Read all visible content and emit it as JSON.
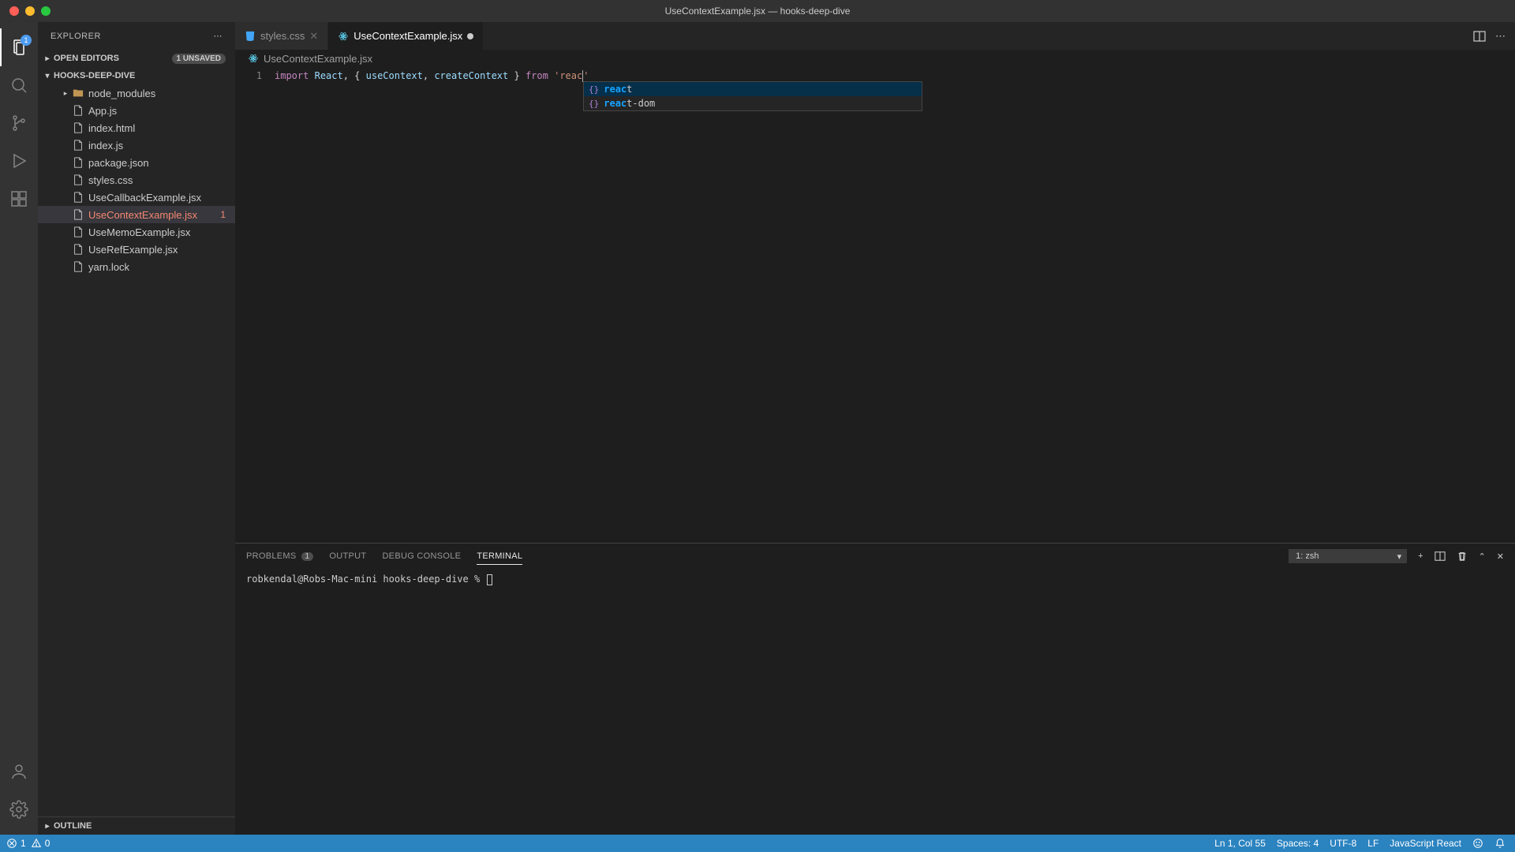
{
  "window": {
    "title": "UseContextExample.jsx — hooks-deep-dive"
  },
  "activity": {
    "explorer_badge": "1"
  },
  "sidebar": {
    "title": "EXPLORER",
    "open_editors_label": "OPEN EDITORS",
    "unsaved_label": "1 UNSAVED",
    "project_label": "HOOKS-DEEP-DIVE",
    "outline_label": "OUTLINE",
    "tree": [
      {
        "name": "node_modules",
        "indent": 1,
        "folder": true
      },
      {
        "name": "App.js",
        "indent": 1
      },
      {
        "name": "index.html",
        "indent": 1
      },
      {
        "name": "index.js",
        "indent": 1
      },
      {
        "name": "package.json",
        "indent": 1
      },
      {
        "name": "styles.css",
        "indent": 1
      },
      {
        "name": "UseCallbackExample.jsx",
        "indent": 1
      },
      {
        "name": "UseContextExample.jsx",
        "indent": 1,
        "error": true,
        "selected": true,
        "badge": "1"
      },
      {
        "name": "UseMemoExample.jsx",
        "indent": 1
      },
      {
        "name": "UseRefExample.jsx",
        "indent": 1
      },
      {
        "name": "yarn.lock",
        "indent": 1
      }
    ]
  },
  "tabs": [
    {
      "label": "styles.css",
      "active": false,
      "modified": false
    },
    {
      "label": "UseContextExample.jsx",
      "active": true,
      "modified": true
    }
  ],
  "breadcrumb": {
    "file": "UseContextExample.jsx"
  },
  "code": {
    "line_number": "1",
    "tokens": {
      "import": "import",
      "react": "React",
      "comma1": ", ",
      "brace_open": "{ ",
      "useContext": "useContext",
      "comma2": ", ",
      "createContext": "createContext",
      "brace_close": " } ",
      "from": "from",
      "space": " ",
      "quote1": "'",
      "str": "reac",
      "quote2": "'"
    }
  },
  "suggest": [
    {
      "match": "reac",
      "rest": "t",
      "selected": true
    },
    {
      "match": "reac",
      "rest": "t-dom",
      "selected": false
    }
  ],
  "panel": {
    "tabs": {
      "problems": "PROBLEMS",
      "problems_count": "1",
      "output": "OUTPUT",
      "debug": "DEBUG CONSOLE",
      "terminal": "TERMINAL"
    },
    "terminal_select": "1: zsh",
    "prompt": "robkendal@Robs-Mac-mini hooks-deep-dive % "
  },
  "status": {
    "errors": "1",
    "warnings": "0",
    "cursor": "Ln 1, Col 55",
    "spaces": "Spaces: 4",
    "encoding": "UTF-8",
    "eol": "LF",
    "language": "JavaScript React"
  }
}
